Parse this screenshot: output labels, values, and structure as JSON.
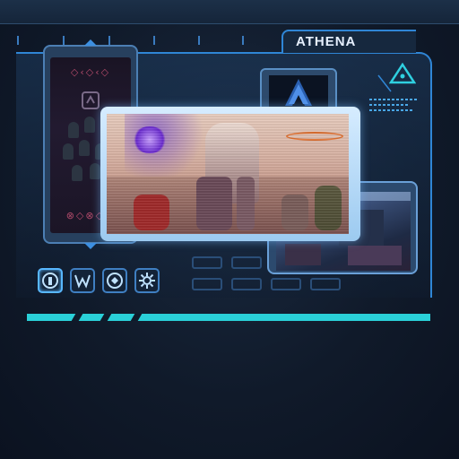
{
  "header": {
    "title": "ATHENA"
  },
  "left_panel": {
    "glyphs_top": "◇‹◇‹◇",
    "glyphs_bottom": "⊗◇⊗◇⊗"
  },
  "a_card": {
    "emblem": "A"
  },
  "toolbar": {
    "buttons": [
      {
        "icon": "profile-icon",
        "glyph": "⓵"
      },
      {
        "icon": "mask-icon",
        "glyph": "Ⓜ"
      },
      {
        "icon": "map-icon",
        "glyph": "◍"
      },
      {
        "icon": "gear-icon",
        "glyph": "⚙"
      }
    ]
  },
  "progress": {
    "value": 1.0
  },
  "colors": {
    "accent": "#2f86d6",
    "progress": "#2ad0d8",
    "background": "#101a2a"
  }
}
